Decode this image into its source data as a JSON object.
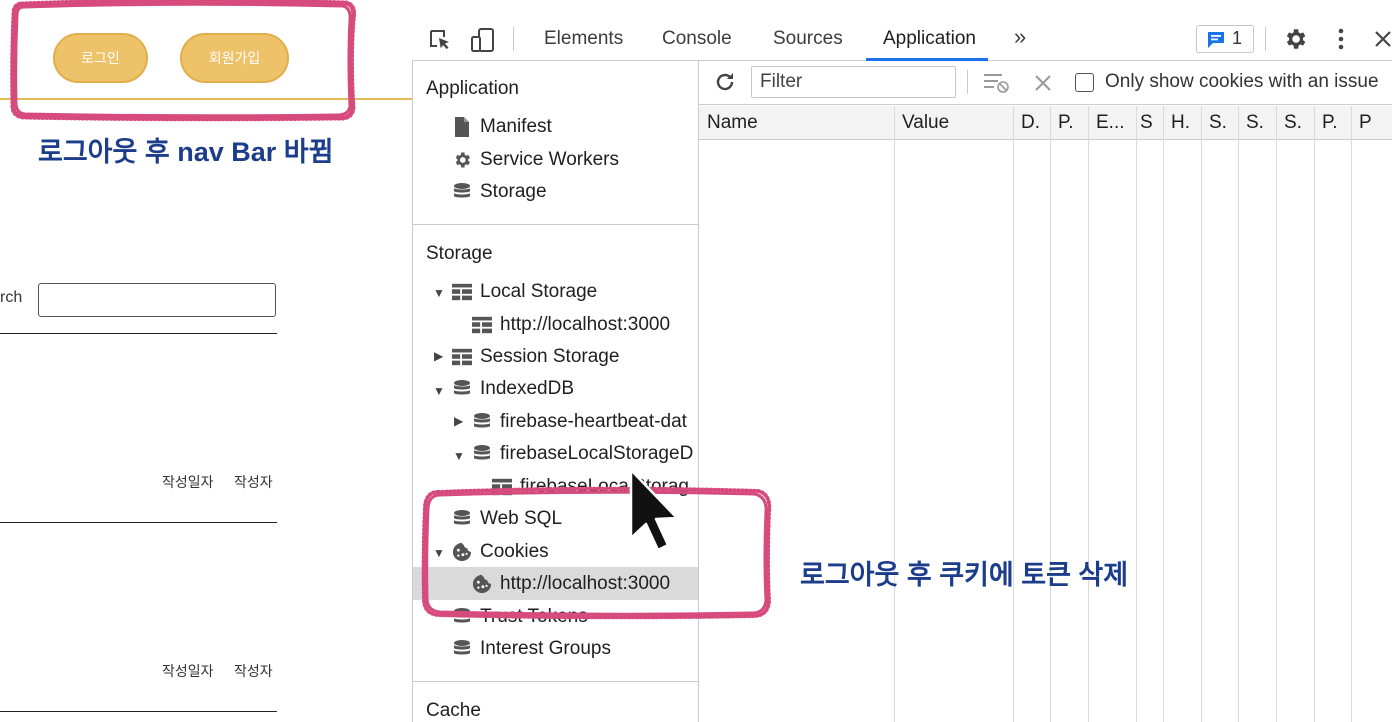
{
  "webpage": {
    "login_button": "로그인",
    "signup_button": "회원가입",
    "search_label": "rch",
    "rows": [
      {
        "date_label": "작성일자",
        "author_label": "작성자"
      },
      {
        "date_label": "작성일자",
        "author_label": "작성자"
      }
    ]
  },
  "annotations": {
    "nav_note": "로그아웃 후 nav Bar 바뀜",
    "cookie_note": "로그아웃 후 쿠키에 토큰 삭제",
    "highlight_color": "#d64a7c"
  },
  "devtools": {
    "tabs": [
      "Elements",
      "Console",
      "Sources",
      "Application"
    ],
    "active_tab": "Application",
    "more_tabs_glyph": "»",
    "issues_count": "1",
    "accent_color": "#1a73e8",
    "sidebar": {
      "application_header": "Application",
      "application_items": [
        {
          "label": "Manifest",
          "icon": "file-icon"
        },
        {
          "label": "Service Workers",
          "icon": "gear-icon"
        },
        {
          "label": "Storage",
          "icon": "database-icon"
        }
      ],
      "storage_header": "Storage",
      "storage_items": [
        {
          "label": "Local Storage",
          "icon": "grid-icon",
          "expanded": true
        },
        {
          "label": "http://localhost:3000",
          "icon": "grid-icon"
        },
        {
          "label": "Session Storage",
          "icon": "grid-icon",
          "expanded": false
        },
        {
          "label": "IndexedDB",
          "icon": "database-icon",
          "expanded": true
        },
        {
          "label": "firebase-heartbeat-dat",
          "icon": "database-icon",
          "expanded": false
        },
        {
          "label": "firebaseLocalStorageD",
          "icon": "database-icon",
          "expanded": true
        },
        {
          "label": "firebaseLocalStorag",
          "icon": "grid-icon"
        },
        {
          "label": "Web SQL",
          "icon": "database-icon"
        },
        {
          "label": "Cookies",
          "icon": "cookie-icon",
          "expanded": true
        },
        {
          "label": "http://localhost:3000",
          "icon": "cookie-icon",
          "selected": true
        },
        {
          "label": "Trust Tokens",
          "icon": "database-icon"
        },
        {
          "label": "Interest Groups",
          "icon": "database-icon"
        }
      ],
      "cache_header": "Cache"
    },
    "toolbar": {
      "filter_placeholder": "Filter",
      "only_issues_label": "Only show cookies with an issue",
      "only_issues_checked": false
    },
    "columns": [
      "Name",
      "Value",
      "D.",
      "P.",
      "E...",
      "S",
      "H.",
      "S.",
      "S.",
      "S.",
      "P.",
      "P"
    ]
  }
}
